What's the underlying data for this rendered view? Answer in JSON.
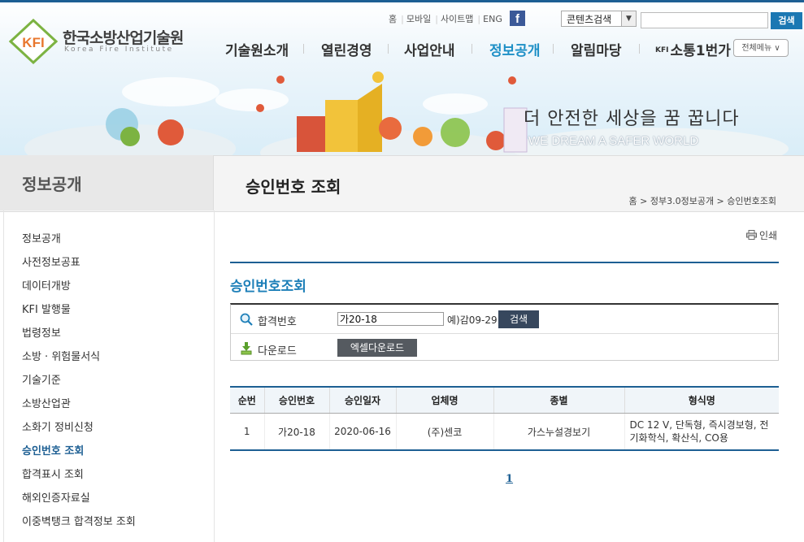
{
  "logo": {
    "mark": "KFI",
    "name_ko": "한국소방산업기술원",
    "name_en": "Korea Fire Institute"
  },
  "util": {
    "home": "홈",
    "mobile": "모바일",
    "sitemap": "사이트맵",
    "eng": "ENG",
    "facebook": "f"
  },
  "search": {
    "scope": "콘텐츠검색",
    "button": "검색",
    "value": ""
  },
  "gnb": [
    "기술원소개",
    "열린경영",
    "사업안내",
    "정보공개",
    "알림마당",
    "소통1번가"
  ],
  "gnb_kfi_prefix": "KFI",
  "all_menu": "전체메뉴 ∨",
  "banner": {
    "slogan": "더 안전한 세상을 꿈 꿉니다",
    "slogan_en": "WE DREAM A SAFER WORLD"
  },
  "lnb": {
    "title": "정보공개",
    "items": [
      "정보공개",
      "사전정보공표",
      "데이터개방",
      "KFI 발행물",
      "법령정보",
      "소방 · 위험물서식",
      "기술기준",
      "소방산업관",
      "소화기 정비신청",
      "승인번호 조회",
      "합격표시 조회",
      "해외인증자료실",
      "이중벽탱크 합격정보 조회"
    ],
    "active": "승인번호 조회"
  },
  "page": {
    "title": "승인번호 조회",
    "breadcrumb": "홈 > 정부3.0정보공개 > 승인번호조회",
    "print": "인쇄",
    "section_title": "승인번호조회"
  },
  "form": {
    "pass_label": "합격번호",
    "pass_value": "가20-18",
    "hint": "예)감09-29",
    "search_button": "검색",
    "download_label": "다운로드",
    "excel_button": "엑셀다운로드"
  },
  "table": {
    "headers": [
      "순번",
      "승인번호",
      "승인일자",
      "업체명",
      "종별",
      "형식명"
    ],
    "rows": [
      [
        "1",
        "가20-18",
        "2020-06-16",
        "(주)센코",
        "가스누설경보기",
        "DC 12 V, 단독형, 즉시경보형, 전기화학식, 확산식, CO용"
      ]
    ]
  },
  "paging": {
    "current": "1"
  },
  "colors": {
    "accent": "#1d8fc6",
    "navy": "#1d5f93"
  }
}
